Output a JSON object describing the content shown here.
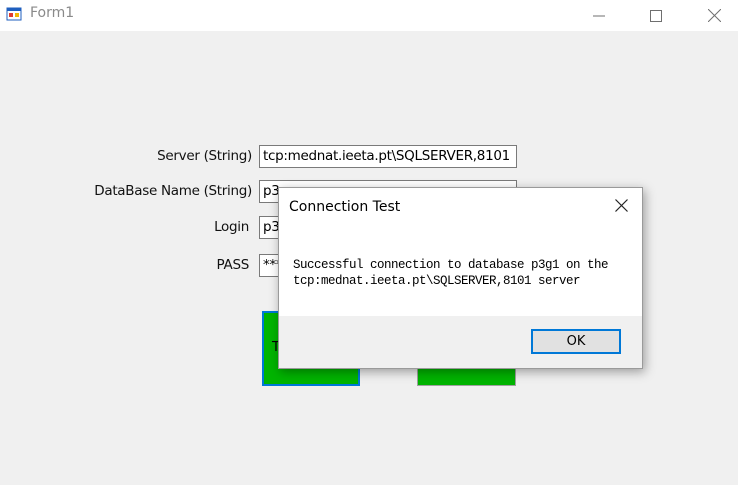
{
  "window": {
    "title": "Form1",
    "icon": "form-app-icon"
  },
  "form": {
    "server_label": "Server (String)",
    "server_value": "tcp:mednat.ieeta.pt\\SQLSERVER,8101",
    "database_label": "DataBase Name (String)",
    "database_value_visible": "p3",
    "login_label": "Login",
    "login_value_visible": "p3",
    "pass_label": "PASS",
    "pass_value_visible": "***",
    "test_button_label_visible": "T"
  },
  "dialog": {
    "title": "Connection Test",
    "message_line1": "Successful connection to database p3g1 on the",
    "message_line2": "tcp:mednat.ieeta.pt\\SQLSERVER,8101 server",
    "ok_label": "OK"
  },
  "colors": {
    "button_green": "#00b400",
    "focus_blue": "#0078d7",
    "window_bg": "#f0f0f0"
  }
}
